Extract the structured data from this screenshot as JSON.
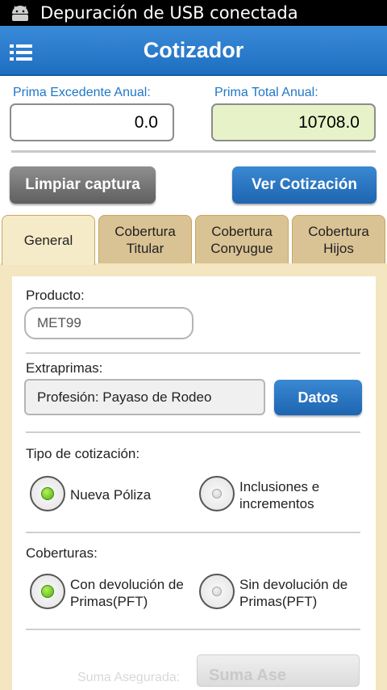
{
  "status_bar": {
    "text": "Depuración de USB conectada"
  },
  "action_bar": {
    "title": "Cotizador",
    "menu_icon": "list-menu-icon"
  },
  "totals": {
    "excedente_label": "Prima Excedente Anual:",
    "excedente_value": "0.0",
    "total_label": "Prima Total Anual:",
    "total_value": "10708.0",
    "total_bg_color": "#e8f2c8"
  },
  "buttons": {
    "clear": "Limpiar captura",
    "view": "Ver Cotización"
  },
  "tabs": [
    {
      "label": "General",
      "active": true
    },
    {
      "label": "Cobertura\nTitular",
      "active": false
    },
    {
      "label": "Cobertura\nConyugue",
      "active": false
    },
    {
      "label": "Cobertura\nHijos",
      "active": false
    }
  ],
  "general": {
    "producto_label": "Producto:",
    "producto_value": "MET99",
    "extraprimas_label": "Extraprimas:",
    "extraprimas_value": "Profesión: Payaso de Rodeo",
    "datos_button": "Datos",
    "tipo_label": "Tipo de cotización:",
    "tipo_options": [
      {
        "label": "Nueva Póliza",
        "selected": true
      },
      {
        "label": "Inclusiones e incrementos",
        "selected": false
      }
    ],
    "coberturas_label": "Coberturas:",
    "cobertura_options": [
      {
        "label": "Con devolución de Primas(PFT)",
        "selected": true
      },
      {
        "label": "Sin devolución de Primas(PFT)",
        "selected": false
      }
    ],
    "bottom_faded_label": "Suma Asegurada:",
    "bottom_button": "Suma Ase"
  },
  "colors": {
    "accent": "#1f77c8",
    "action_bar": "#2a7dcd",
    "tab_active": "#f6ebc8",
    "tab_inactive": "#d9c394"
  }
}
